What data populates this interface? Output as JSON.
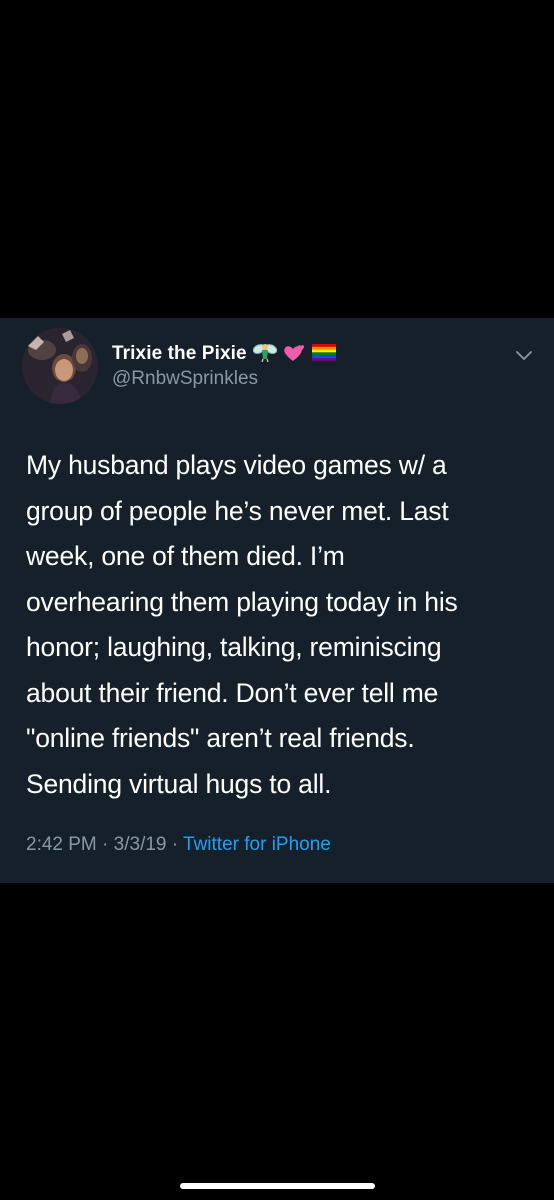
{
  "tweet": {
    "display_name": "Trixie the Pixie",
    "name_emoji": [
      "fairy-emoji",
      "two-hearts-emoji",
      "rainbow-flag-emoji"
    ],
    "handle": "@RnbwSprinkles",
    "text_lines": [
      "My husband plays video games w/ a",
      "group of people he’s never met. Last",
      "week, one of them died. I’m",
      "overhearing them playing today in his",
      "honor; laughing, talking, reminiscing",
      "about their friend. Don’t ever tell me",
      "\"online friends\" aren’t real friends.",
      "Sending virtual hugs to all."
    ],
    "time": "2:42 PM",
    "separator": " · ",
    "date": "3/3/19",
    "source": "Twitter for iPhone"
  },
  "colors": {
    "page_background": "#000000",
    "card_background": "#15202b",
    "primary_text": "#ffffff",
    "secondary_text": "#8899a6",
    "link": "#1da1f2"
  },
  "icons": {
    "menu": "chevron-down-icon",
    "avatar": "profile-photo"
  }
}
